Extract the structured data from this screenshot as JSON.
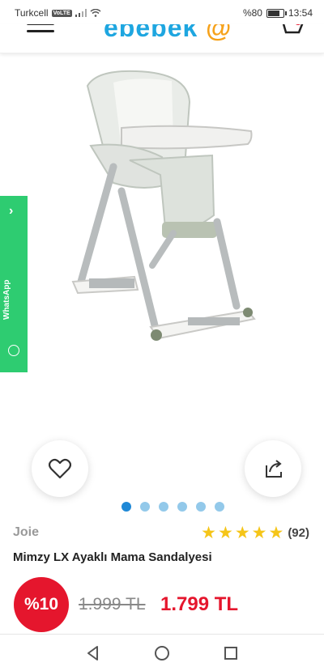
{
  "status_bar": {
    "carrier": "Turkcell",
    "volte": "VoLTE",
    "battery": "%80",
    "time": "13:54",
    "battery_level": 0.8
  },
  "header": {
    "logo_text": "ebebek",
    "menu_icon": "hamburger-icon",
    "cart_icon": "cart-icon"
  },
  "whatsapp": {
    "label": "WhatsApp",
    "arrow": "›",
    "color": "#2ecc71"
  },
  "gallery": {
    "dots_total": 6,
    "active_index": 0
  },
  "product": {
    "brand": "Joie",
    "title": "Mimzy LX Ayaklı Mama Sandalyesi",
    "rating_stars": 5,
    "review_count": "(92)",
    "discount": "%10",
    "old_price": "1.999 TL",
    "new_price": "1.799 TL"
  },
  "colors": {
    "accent_blue": "#1ea6e0",
    "price_red": "#e5162d",
    "star_yellow": "#f5c518"
  }
}
